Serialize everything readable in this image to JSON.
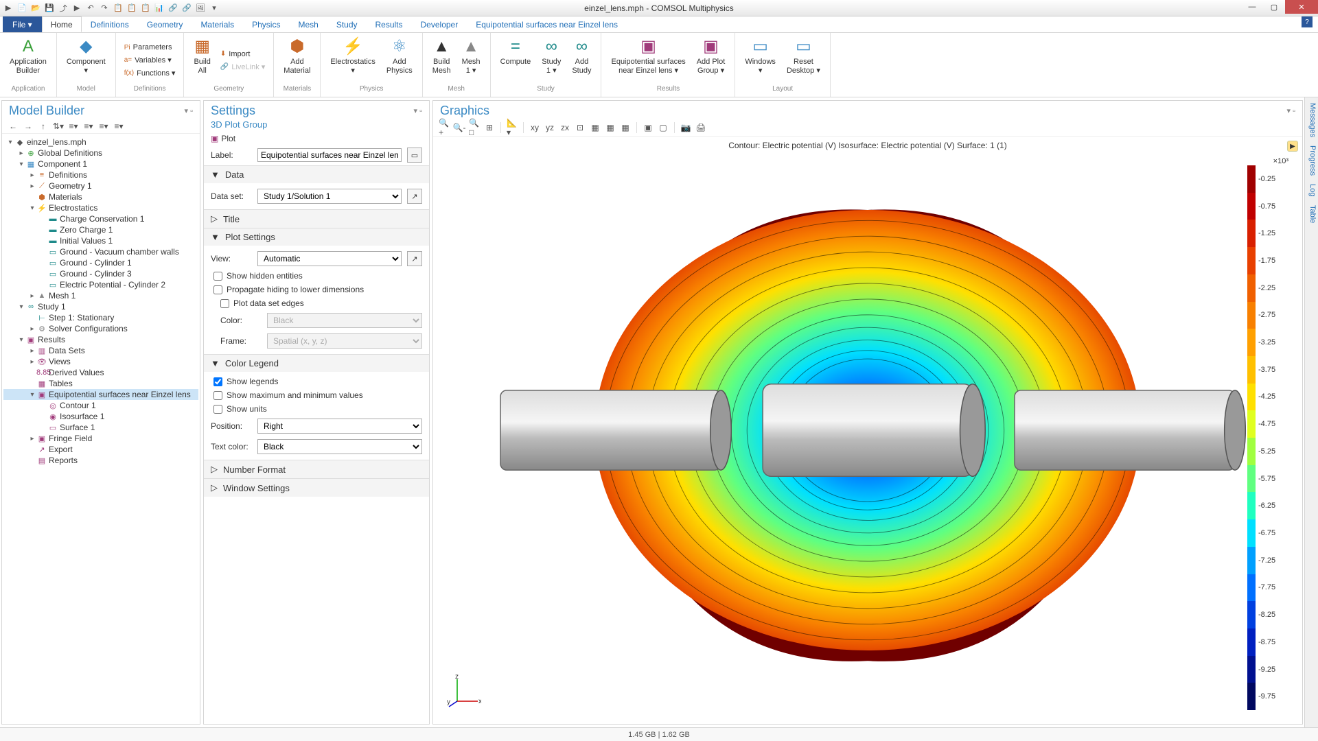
{
  "window": {
    "title": "einzel_lens.mph - COMSOL Multiphysics",
    "min": "—",
    "max": "▢",
    "close": "✕"
  },
  "qat": [
    "▶",
    "📄",
    "📂",
    "💾",
    "⤴",
    "▶",
    "↶",
    "↷",
    "📋",
    "📋",
    "📋",
    "📊",
    "🔗",
    "🔗",
    "🖼",
    "▾"
  ],
  "menu": {
    "file": "File ▾",
    "tabs": [
      "Home",
      "Definitions",
      "Geometry",
      "Materials",
      "Physics",
      "Mesh",
      "Study",
      "Results",
      "Developer",
      "Equipotential surfaces near Einzel lens"
    ],
    "active": 0
  },
  "ribbon": {
    "groups": [
      {
        "label": "Application",
        "items": [
          {
            "icon": "A",
            "text": "Application\nBuilder",
            "color": "#3aa03a"
          }
        ]
      },
      {
        "label": "Model",
        "items": [
          {
            "icon": "◆",
            "text": "Component\n▾",
            "color": "#3b8ac4"
          }
        ]
      },
      {
        "label": "Definitions",
        "small": [
          {
            "icon": "Pi",
            "text": "Parameters"
          },
          {
            "icon": "a=",
            "text": "Variables ▾"
          },
          {
            "icon": "f(x)",
            "text": "Functions ▾"
          }
        ]
      },
      {
        "label": "Geometry",
        "items": [
          {
            "icon": "▦",
            "text": "Build\nAll",
            "color": "#c96a2b"
          }
        ],
        "small": [
          {
            "icon": "⬇",
            "text": "Import"
          },
          {
            "icon": "🔗",
            "text": "LiveLink ▾",
            "dim": true
          }
        ]
      },
      {
        "label": "Materials",
        "items": [
          {
            "icon": "⬢",
            "text": "Add\nMaterial",
            "color": "#c96a2b"
          }
        ]
      },
      {
        "label": "Physics",
        "items": [
          {
            "icon": "⚡",
            "text": "Electrostatics\n▾",
            "color": "#3b8ac4"
          },
          {
            "icon": "⚛",
            "text": "Add\nPhysics",
            "color": "#3b8ac4"
          }
        ]
      },
      {
        "label": "Mesh",
        "items": [
          {
            "icon": "▲",
            "text": "Build\nMesh",
            "color": "#333"
          },
          {
            "icon": "▲",
            "text": "Mesh\n1 ▾",
            "color": "#888"
          }
        ]
      },
      {
        "label": "Study",
        "items": [
          {
            "icon": "=",
            "text": "Compute",
            "color": "#1e8a8a"
          },
          {
            "icon": "∞",
            "text": "Study\n1 ▾",
            "color": "#1e8a8a"
          },
          {
            "icon": "∞",
            "text": "Add\nStudy",
            "color": "#1e8a8a"
          }
        ]
      },
      {
        "label": "Results",
        "items": [
          {
            "icon": "▣",
            "text": "Equipotential surfaces\nnear Einzel lens ▾",
            "color": "#a03a7a"
          },
          {
            "icon": "▣",
            "text": "Add Plot\nGroup ▾",
            "color": "#a03a7a"
          }
        ]
      },
      {
        "label": "Layout",
        "items": [
          {
            "icon": "▭",
            "text": "Windows\n▾",
            "color": "#3b8ac4"
          },
          {
            "icon": "▭",
            "text": "Reset\nDesktop ▾",
            "color": "#3b8ac4"
          }
        ]
      }
    ]
  },
  "modelBuilder": {
    "title": "Model Builder",
    "toolbar": [
      "←",
      "→",
      "↑",
      "⇅▾",
      "≡▾",
      "≡▾",
      "≡▾",
      "≡▾"
    ],
    "tree": [
      {
        "d": 0,
        "tw": "▾",
        "icon": "◆",
        "label": "einzel_lens.mph",
        "c": "#555"
      },
      {
        "d": 1,
        "tw": "▸",
        "icon": "⊕",
        "label": "Global Definitions",
        "c": "#3aa03a"
      },
      {
        "d": 1,
        "tw": "▾",
        "icon": "▦",
        "label": "Component 1",
        "c": "#3b8ac4"
      },
      {
        "d": 2,
        "tw": "▸",
        "icon": "≡",
        "label": "Definitions",
        "c": "#c96a2b"
      },
      {
        "d": 2,
        "tw": "▸",
        "icon": "⟋",
        "label": "Geometry 1",
        "c": "#c96a2b"
      },
      {
        "d": 2,
        "tw": "",
        "icon": "⬢",
        "label": "Materials",
        "c": "#c96a2b"
      },
      {
        "d": 2,
        "tw": "▾",
        "icon": "⚡",
        "label": "Electrostatics",
        "c": "#c96a2b"
      },
      {
        "d": 3,
        "tw": "",
        "icon": "▬",
        "label": "Charge Conservation 1",
        "c": "#1e8a8a"
      },
      {
        "d": 3,
        "tw": "",
        "icon": "▬",
        "label": "Zero Charge 1",
        "c": "#1e8a8a"
      },
      {
        "d": 3,
        "tw": "",
        "icon": "▬",
        "label": "Initial Values 1",
        "c": "#1e8a8a"
      },
      {
        "d": 3,
        "tw": "",
        "icon": "▭",
        "label": "Ground - Vacuum chamber walls",
        "c": "#1e8a8a"
      },
      {
        "d": 3,
        "tw": "",
        "icon": "▭",
        "label": "Ground - Cylinder 1",
        "c": "#1e8a8a"
      },
      {
        "d": 3,
        "tw": "",
        "icon": "▭",
        "label": "Ground - Cylinder 3",
        "c": "#1e8a8a"
      },
      {
        "d": 3,
        "tw": "",
        "icon": "▭",
        "label": "Electric Potential - Cylinder 2",
        "c": "#1e8a8a"
      },
      {
        "d": 2,
        "tw": "▸",
        "icon": "▲",
        "label": "Mesh 1",
        "c": "#888"
      },
      {
        "d": 1,
        "tw": "▾",
        "icon": "∞",
        "label": "Study 1",
        "c": "#1e8a8a"
      },
      {
        "d": 2,
        "tw": "",
        "icon": "⊢",
        "label": "Step 1: Stationary",
        "c": "#1e8a8a"
      },
      {
        "d": 2,
        "tw": "▸",
        "icon": "⚙",
        "label": "Solver Configurations",
        "c": "#888"
      },
      {
        "d": 1,
        "tw": "▾",
        "icon": "▣",
        "label": "Results",
        "c": "#a03a7a"
      },
      {
        "d": 2,
        "tw": "▸",
        "icon": "▥",
        "label": "Data Sets",
        "c": "#a03a7a"
      },
      {
        "d": 2,
        "tw": "▸",
        "icon": "👁",
        "label": "Views",
        "c": "#a03a7a"
      },
      {
        "d": 2,
        "tw": "",
        "icon": "8.85",
        "label": "Derived Values",
        "c": "#a03a7a"
      },
      {
        "d": 2,
        "tw": "",
        "icon": "▦",
        "label": "Tables",
        "c": "#a03a7a"
      },
      {
        "d": 2,
        "tw": "▾",
        "icon": "▣",
        "label": "Equipotential surfaces near Einzel lens",
        "c": "#a03a7a",
        "sel": true
      },
      {
        "d": 3,
        "tw": "",
        "icon": "◎",
        "label": "Contour 1",
        "c": "#a03a7a"
      },
      {
        "d": 3,
        "tw": "",
        "icon": "◉",
        "label": "Isosurface 1",
        "c": "#a03a7a"
      },
      {
        "d": 3,
        "tw": "",
        "icon": "▭",
        "label": "Surface 1",
        "c": "#a03a7a"
      },
      {
        "d": 2,
        "tw": "▸",
        "icon": "▣",
        "label": "Fringe Field",
        "c": "#a03a7a"
      },
      {
        "d": 2,
        "tw": "",
        "icon": "↗",
        "label": "Export",
        "c": "#a03a7a"
      },
      {
        "d": 2,
        "tw": "",
        "icon": "▤",
        "label": "Reports",
        "c": "#a03a7a"
      }
    ]
  },
  "settings": {
    "title": "Settings",
    "subtitle": "3D Plot Group",
    "plotIcon": "▣",
    "plotLabel": "Plot",
    "labelField": {
      "label": "Label:",
      "value": "Equipotential surfaces near Einzel lens"
    },
    "sections": {
      "data": {
        "title": "Data",
        "dataset_label": "Data set:",
        "dataset": "Study 1/Solution 1"
      },
      "titleSec": {
        "title": "Title"
      },
      "plotSettings": {
        "title": "Plot Settings",
        "view_label": "View:",
        "view": "Automatic",
        "chk1": "Show hidden entities",
        "chk2": "Propagate hiding to lower dimensions",
        "chk3": "Plot data set edges",
        "color_label": "Color:",
        "color": "Black",
        "frame_label": "Frame:",
        "frame": "Spatial  (x, y, z)"
      },
      "colorLegend": {
        "title": "Color Legend",
        "chk1": "Show legends",
        "chk2": "Show maximum and minimum values",
        "chk3": "Show units",
        "pos_label": "Position:",
        "pos": "Right",
        "tc_label": "Text color:",
        "tc": "Black"
      },
      "numberFormat": {
        "title": "Number Format"
      },
      "windowSettings": {
        "title": "Window Settings"
      }
    }
  },
  "graphics": {
    "title": "Graphics",
    "toolbar": [
      "🔍+",
      "🔍-",
      "🔍□",
      "⊞",
      "|",
      "📐▾",
      "|",
      "xy",
      "yz",
      "zx",
      "⊡",
      "▦",
      "▦",
      "▦",
      "|",
      "▣",
      "▢",
      "|",
      "📷",
      "🖨"
    ],
    "caption": "Contour: Electric potential (V)   Isosurface: Electric potential (V)   Surface: 1 (1)",
    "axis": {
      "x": "x",
      "y": "y",
      "z": "z"
    }
  },
  "legend": {
    "exp": "×10³",
    "ticks": [
      -0.25,
      -0.75,
      -1.25,
      -1.75,
      -2.25,
      -2.75,
      -3.25,
      -3.75,
      -4.25,
      -4.75,
      -5.25,
      -5.75,
      -6.25,
      -6.75,
      -7.25,
      -7.75,
      -8.25,
      -8.75,
      -9.25,
      -9.75
    ],
    "colors": [
      "#a00000",
      "#c00000",
      "#d82000",
      "#e84000",
      "#f06000",
      "#f88000",
      "#ffa000",
      "#ffc000",
      "#ffe000",
      "#e0ff20",
      "#a0ff40",
      "#60ff80",
      "#20ffc0",
      "#00e0ff",
      "#00a0ff",
      "#0070ff",
      "#0040e0",
      "#0020c0",
      "#001090",
      "#000860"
    ]
  },
  "sidebar": [
    "Messages",
    "Progress",
    "Log",
    "Table"
  ],
  "status": "1.45 GB | 1.62 GB"
}
